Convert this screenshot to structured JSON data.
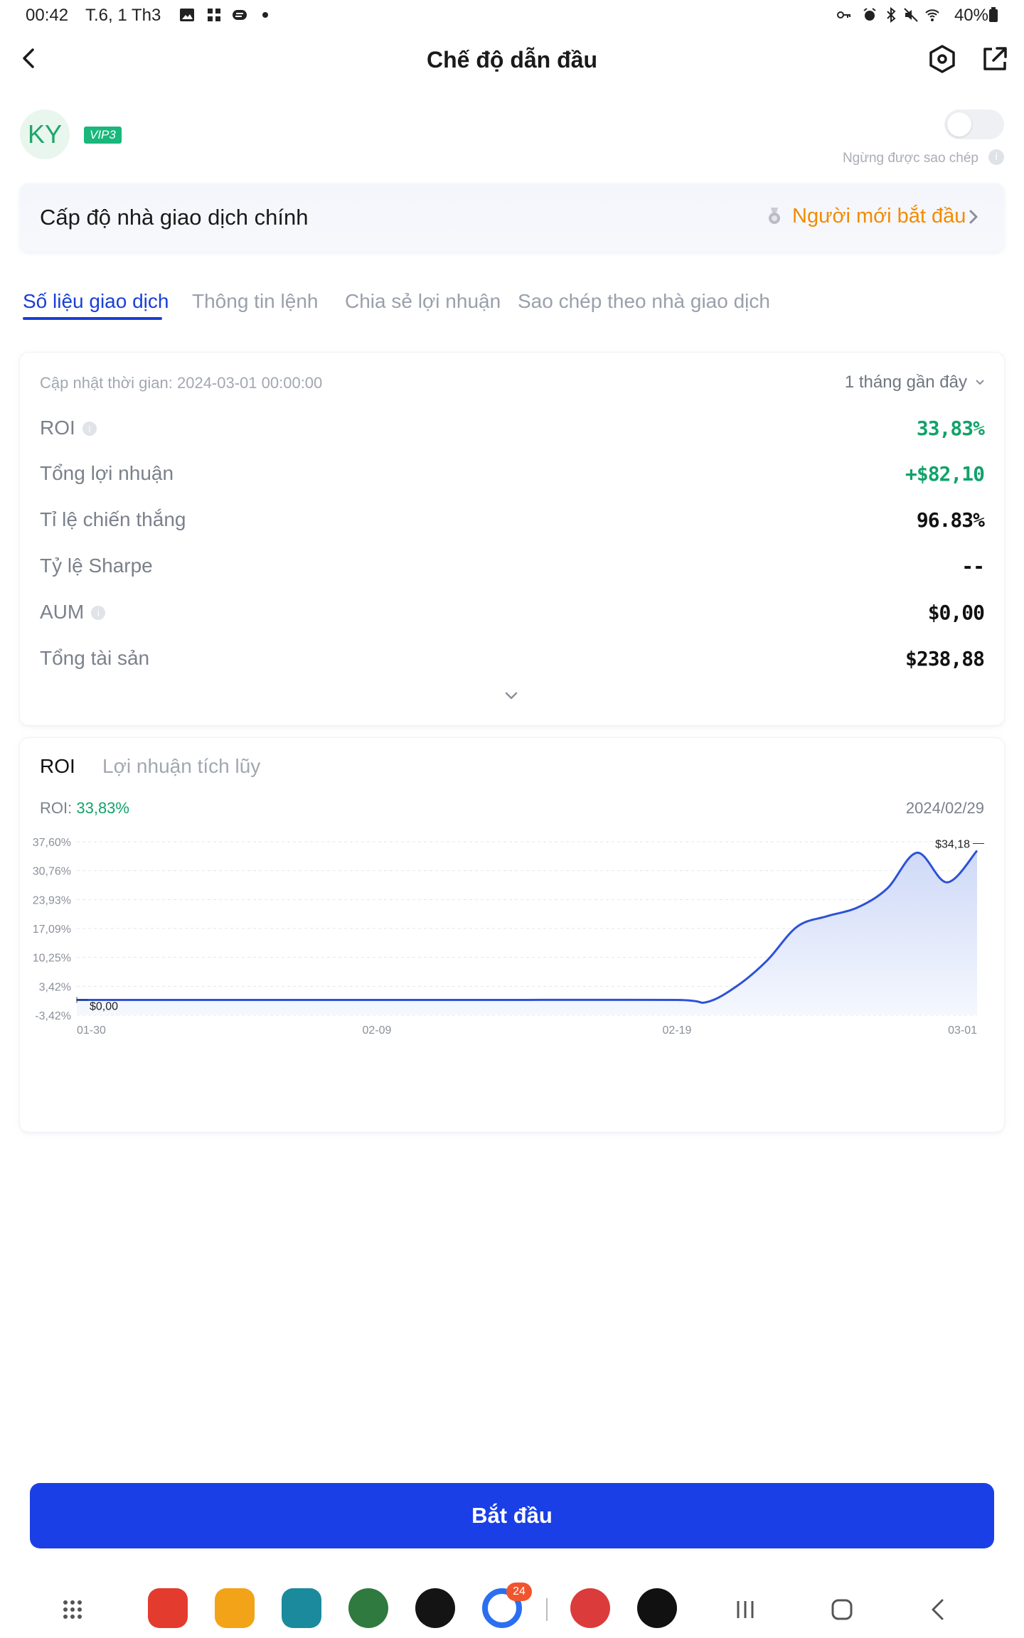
{
  "status_bar": {
    "time": "00:42",
    "date": "T.6, 1 Th3",
    "battery": "40%"
  },
  "header": {
    "title": "Chế độ dẫn đầu"
  },
  "profile": {
    "avatar_initials": "KY",
    "vip": "VIP3",
    "copy_status": "Ngừng được sao chép"
  },
  "level": {
    "label": "Cấp độ nhà giao dịch chính",
    "value": "Người mới bắt đầu"
  },
  "tabs": [
    "Số liệu giao dịch",
    "Thông tin lệnh",
    "Chia sẻ lợi nhuận",
    "Sao chép theo nhà giao dịch"
  ],
  "stats": {
    "update_time": "Cập nhật thời gian: 2024-03-01 00:00:00",
    "period": "1 tháng gần đây",
    "rows": [
      {
        "label": "ROI",
        "value": "33,83%"
      },
      {
        "label": "Tổng lợi nhuận",
        "value": "+$82,10"
      },
      {
        "label": "Tỉ lệ chiến thắng",
        "value": "96.83%"
      },
      {
        "label": "Tỷ lệ Sharpe",
        "value": "--"
      },
      {
        "label": "AUM",
        "value": "$0,00"
      },
      {
        "label": "Tổng tài sản",
        "value": "$238,88"
      }
    ]
  },
  "chart_tabs": [
    "ROI",
    "Lợi nhuận tích lũy"
  ],
  "chart_summary": {
    "label": "ROI:",
    "value": "33,83%",
    "date": "2024/02/29"
  },
  "chart_data": {
    "type": "area",
    "y_ticks": [
      "37,60%",
      "30,76%",
      "23,93%",
      "17,09%",
      "10,25%",
      "3,42%",
      "-3,42%"
    ],
    "x_ticks": [
      "01-30",
      "02-09",
      "02-19",
      "03-01"
    ],
    "ylim": [
      -3.42,
      37.6
    ],
    "x": [
      0,
      5,
      10,
      15,
      20,
      21,
      22,
      23,
      24,
      25,
      26,
      27,
      28,
      29,
      30
    ],
    "y": [
      0.2,
      0.2,
      0.2,
      0.2,
      0.2,
      -0.3,
      3.5,
      9.5,
      17.5,
      20.0,
      22.0,
      26.5,
      35.0,
      28.0,
      35.5
    ],
    "max_label": "$34,18",
    "min_label": "$0,00",
    "colors": {
      "line": "#2d52d6",
      "fill_top": "#c9d5f6",
      "fill_bottom": "#f4f7fe"
    }
  },
  "action": {
    "start": "Bắt đầu"
  },
  "dock": {
    "apps": [
      {
        "name": "notes-app-icon",
        "color": "#e33b2e"
      },
      {
        "name": "files-app-icon",
        "color": "#f2a318"
      },
      {
        "name": "calendar-app-icon",
        "color": "#1b8a9c"
      },
      {
        "name": "photos-app-icon",
        "color": "#2f7a3f"
      },
      {
        "name": "tradingview-app-icon",
        "color": "#141414"
      },
      {
        "name": "chrome-app-icon",
        "color": "#ecedf0"
      },
      {
        "name": "expressvpn-app-icon",
        "color": "#db3b3b"
      },
      {
        "name": "tiktok-app-icon",
        "color": "#111111"
      }
    ],
    "badge": "24"
  }
}
